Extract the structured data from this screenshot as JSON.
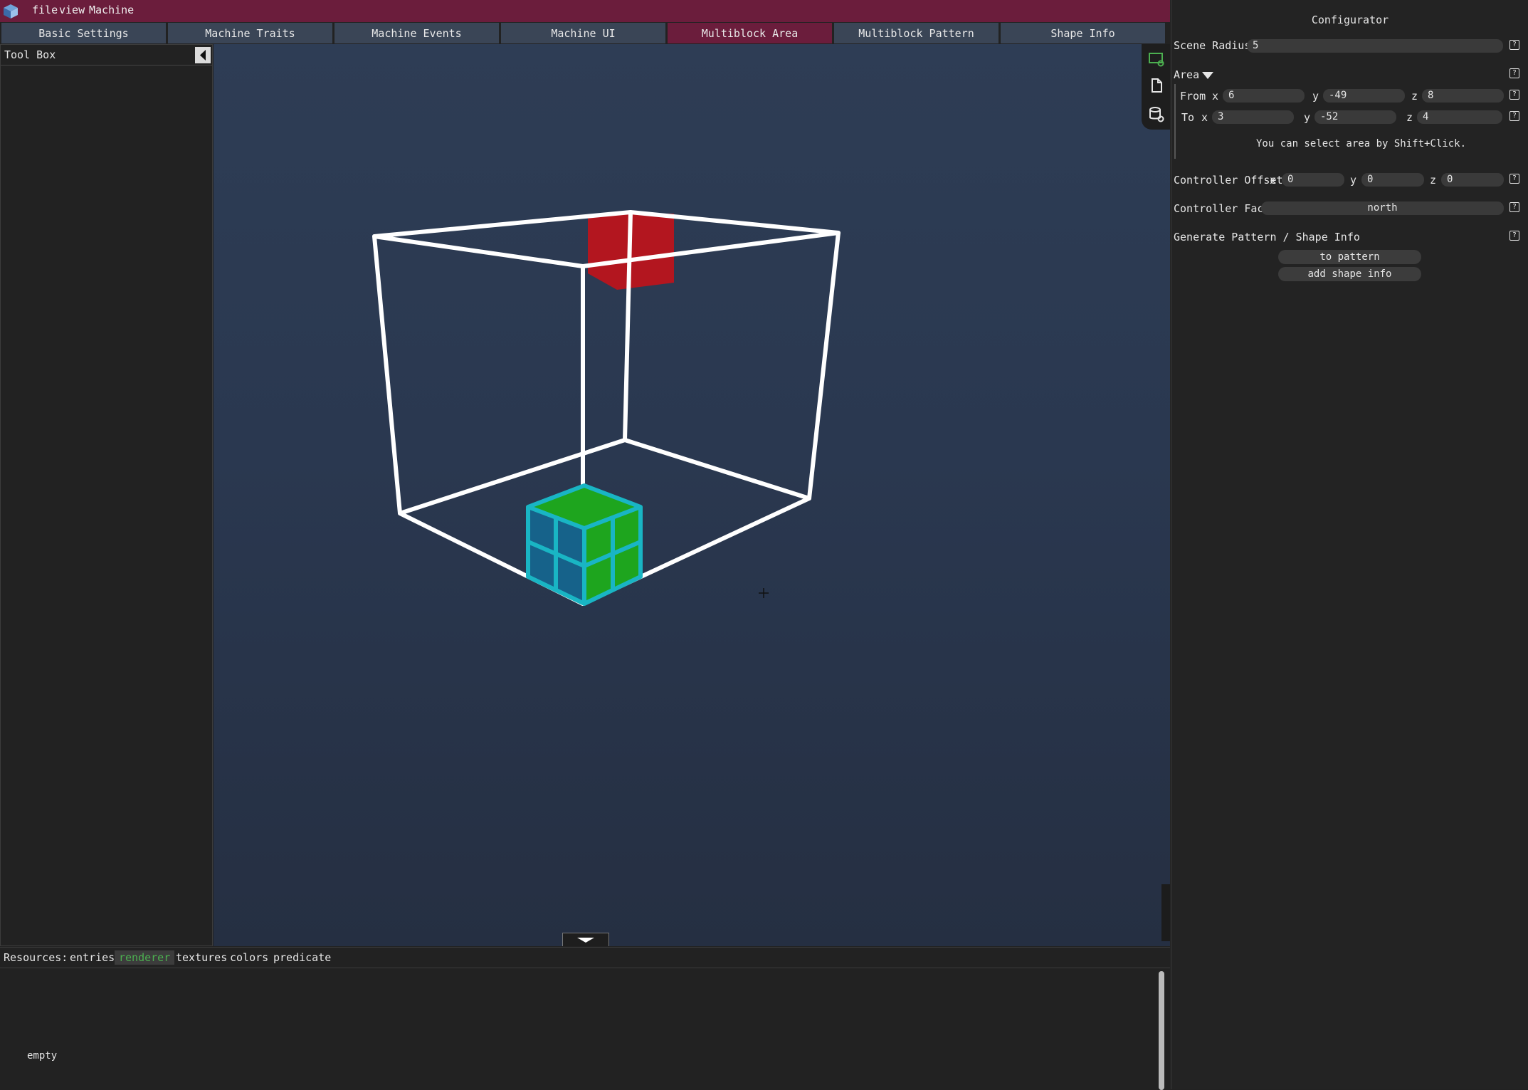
{
  "menu": {
    "app_icon": "app-cube-icon",
    "items": [
      "file",
      "view",
      "Machine"
    ]
  },
  "tabs": [
    {
      "label": "Basic Settings",
      "active": false
    },
    {
      "label": "Machine Traits",
      "active": false
    },
    {
      "label": "Machine Events",
      "active": false
    },
    {
      "label": "Machine UI",
      "active": false
    },
    {
      "label": "Multiblock Area",
      "active": true
    },
    {
      "label": "Multiblock Pattern",
      "active": false
    },
    {
      "label": "Shape Info",
      "active": false
    }
  ],
  "toolbox": {
    "title": "Tool Box",
    "collapse_icon": "chevron-left-icon"
  },
  "viewport": {
    "side_tools": [
      "monitor-settings-icon",
      "document-icon",
      "database-settings-icon"
    ],
    "drawer_icon": "chevron-down-icon"
  },
  "resources": {
    "label": "Resources:",
    "tabs": [
      {
        "label": "entries",
        "active": false
      },
      {
        "label": "renderer",
        "active": true
      },
      {
        "label": "textures",
        "active": false
      },
      {
        "label": "colors",
        "active": false
      },
      {
        "label": "predicate",
        "active": false
      }
    ],
    "empty_text": "empty"
  },
  "configurator": {
    "title": "Configurator",
    "scene_radius": {
      "label": "Scene Radius",
      "value": "5"
    },
    "area": {
      "label": "Area",
      "from": {
        "label": "From",
        "x_label": "x",
        "x": "6",
        "y_label": "y",
        "y": "-49",
        "z_label": "z",
        "z": "8"
      },
      "to": {
        "label": "To",
        "x_label": "x",
        "x": "3",
        "y_label": "y",
        "y": "-52",
        "z_label": "z",
        "z": "4"
      },
      "hint": "You can select area by Shift+Click."
    },
    "controller_offset": {
      "label": "Controller Offset",
      "x_label": "x",
      "x": "0",
      "y_label": "y",
      "y": "0",
      "z_label": "z",
      "z": "0"
    },
    "controller_face": {
      "label": "Controller Face",
      "value": "north"
    },
    "generate": {
      "label": "Generate Pattern / Shape Info",
      "to_pattern": "to pattern",
      "add_shape_info": "add shape info"
    },
    "help_glyph": "?"
  },
  "colors": {
    "menubar": "#6b1d3c",
    "tab": "#3a4556",
    "tab_active": "#6b1d3c",
    "controller_block": "#b3161f",
    "selected_block_green": "#1ea51e",
    "selected_block_blue": "#16628a",
    "selection_outline": "#19b5c4",
    "wireframe": "#ffffff",
    "accent_green": "#4caf50"
  }
}
